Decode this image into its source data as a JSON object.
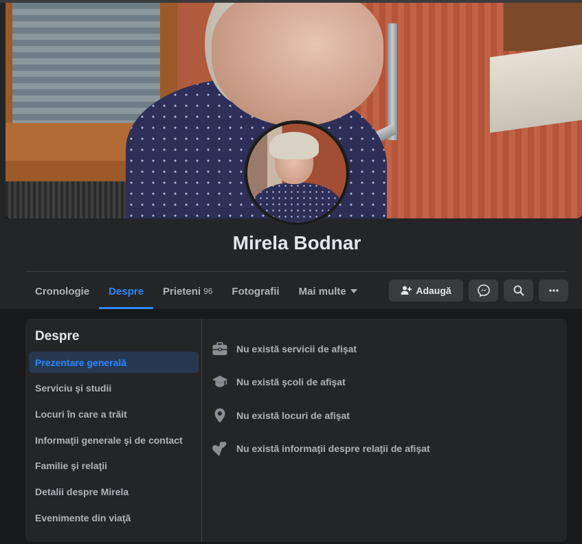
{
  "profile": {
    "name": "Mirela Bodnar"
  },
  "tabs": [
    {
      "label": "Cronologie"
    },
    {
      "label": "Despre"
    },
    {
      "label": "Prieteni",
      "count": "96"
    },
    {
      "label": "Fotografii"
    },
    {
      "label": "Mai multe"
    }
  ],
  "actions": {
    "add_label": "Adaugă",
    "add_icon": "add-friend-icon",
    "messenger_icon": "messenger-icon",
    "search_icon": "search-icon",
    "more_icon": "more-icon"
  },
  "about": {
    "title": "Despre",
    "nav": [
      {
        "label": "Prezentare generală"
      },
      {
        "label": "Serviciu şi studii"
      },
      {
        "label": "Locuri în care a trăit"
      },
      {
        "label": "Informaţii generale şi de contact"
      },
      {
        "label": "Familie şi relaţii"
      },
      {
        "label": "Detalii despre Mirela"
      },
      {
        "label": "Evenimente din viaţă"
      }
    ],
    "items": [
      {
        "icon": "briefcase-icon",
        "text": "Nu există servicii de afişat"
      },
      {
        "icon": "graduation-cap-icon",
        "text": "Nu există şcoli de afişat"
      },
      {
        "icon": "location-pin-icon",
        "text": "Nu există locuri de afişat"
      },
      {
        "icon": "hearts-icon",
        "text": "Nu există informaţii despre relaţii de afişat"
      }
    ]
  },
  "colors": {
    "accent": "#2d88ff",
    "background": "#18191a",
    "surface": "#242526",
    "button": "#3a3b3c"
  }
}
